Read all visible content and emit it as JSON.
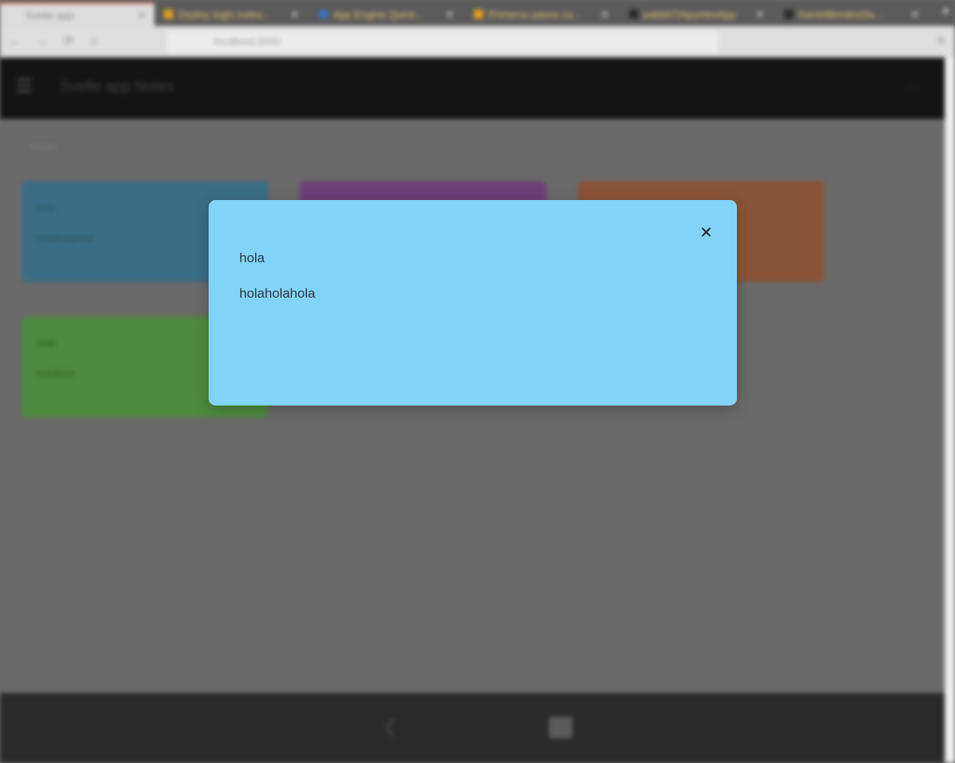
{
  "browser": {
    "tabs": [
      {
        "label": "Svelte app",
        "active": true,
        "favicon": "svelte-icon"
      },
      {
        "label": "Deploy login notes...",
        "active": false,
        "favicon": "folder-icon"
      },
      {
        "label": "App Engine Quick...",
        "active": false,
        "favicon": "google-cloud-icon"
      },
      {
        "label": "Primeros pasos co...",
        "active": false,
        "favicon": "folder-icon"
      },
      {
        "label": "pabb07/ApuntesApp",
        "active": false,
        "favicon": "github-icon"
      },
      {
        "label": "DanielBenitezDe...",
        "active": false,
        "favicon": "github-icon"
      }
    ],
    "tab_close_glyph": "✕",
    "new_tab_glyph": "+",
    "url": "localhost:5000",
    "icons": {
      "back": "←",
      "forward": "→",
      "reload": "⟳",
      "home": "⌂",
      "menu": "≡"
    }
  },
  "app": {
    "title": "Svelte app Notes",
    "menu_glyph": "☰",
    "right_glyph": "⋯",
    "section_label": "Notas",
    "notes": [
      {
        "color": "blue",
        "title": "hola",
        "body": "holaholahola"
      },
      {
        "color": "purple",
        "title": "",
        "body": ""
      },
      {
        "color": "orange",
        "title": "",
        "body": ""
      },
      {
        "color": "green",
        "title": "hola",
        "body": "holahola"
      }
    ],
    "bottom_bar": {
      "moon_glyph": "☾"
    }
  },
  "modal": {
    "close_glyph": "✕",
    "title": "hola",
    "body": "holaholahola",
    "background_color": "#81d4f7"
  }
}
